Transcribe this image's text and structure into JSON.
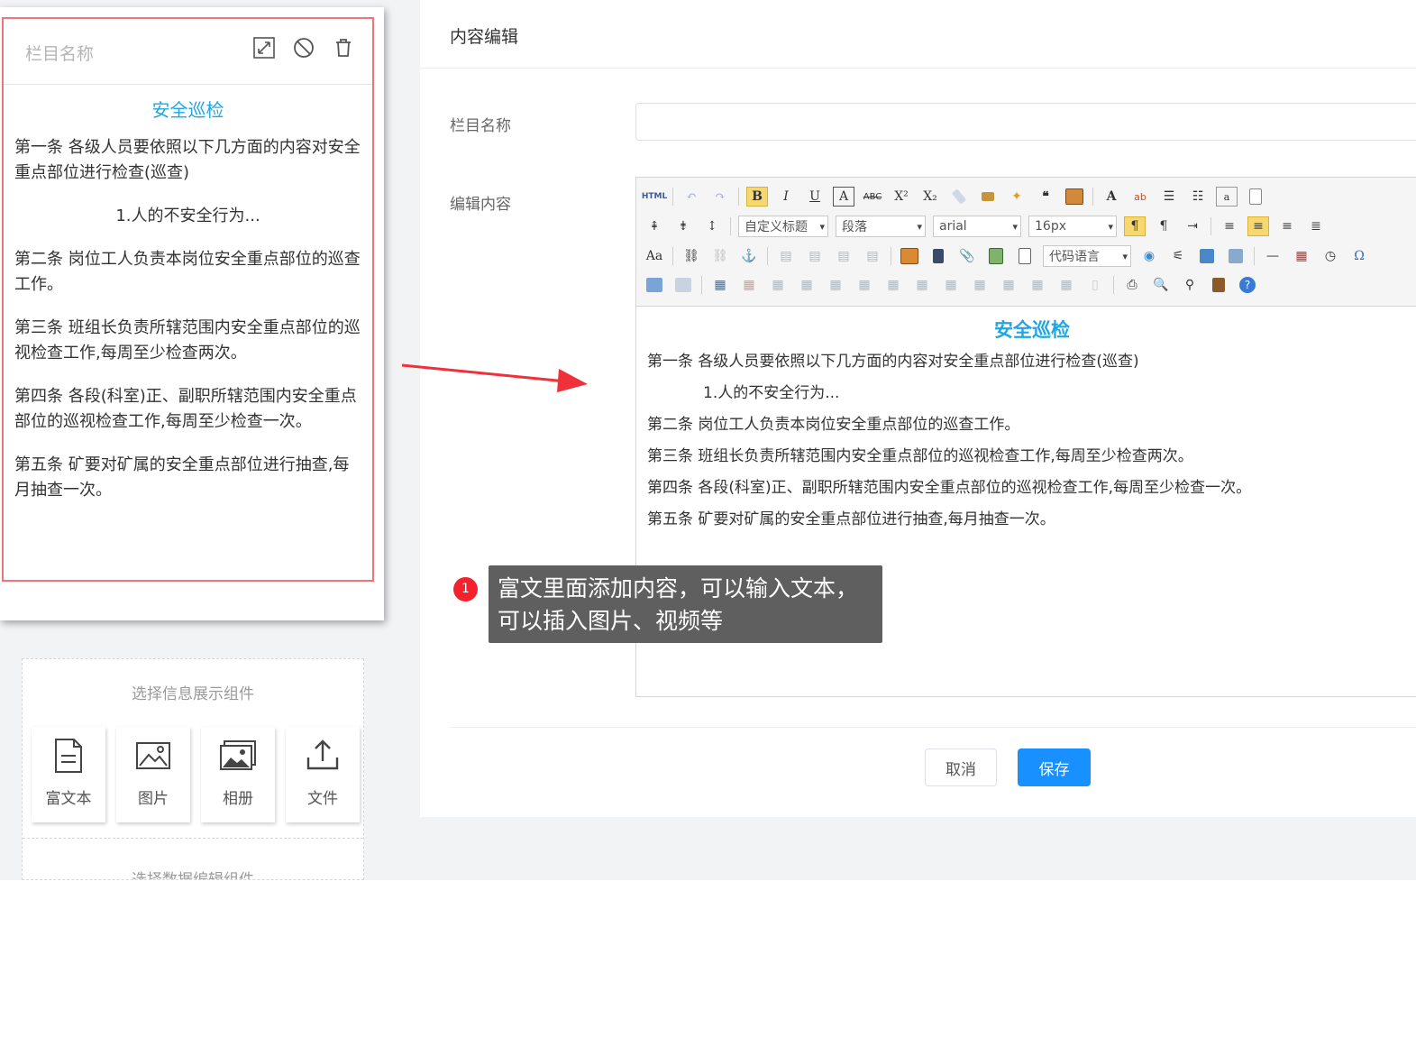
{
  "preview": {
    "column_name_placeholder": "栏目名称",
    "title": "安全巡检",
    "paragraphs": [
      "第一条  各级人员要依照以下几方面的内容对安全重点部位进行检查(巡查)",
      "1.人的不安全行为...",
      "第二条  岗位工人负责本岗位安全重点部位的巡查工作。",
      "第三条  班组长负责所辖范围内安全重点部位的巡视检查工作,每周至少检查两次。",
      "第四条  各段(科室)正、副职所辖范围内安全重点部位的巡视检查工作,每周至少检查一次。",
      "第五条  矿要对矿属的安全重点部位进行抽查,每月抽查一次。"
    ]
  },
  "picker": {
    "title": "选择信息展示组件",
    "components": [
      {
        "label": "富文本",
        "icon": "document-icon"
      },
      {
        "label": "图片",
        "icon": "image-icon"
      },
      {
        "label": "相册",
        "icon": "album-icon"
      },
      {
        "label": "文件",
        "icon": "upload-icon"
      }
    ],
    "title2": "选择数据编辑组件"
  },
  "editor_panel": {
    "title": "内容编辑",
    "column_name_label": "栏目名称",
    "column_name_value": "",
    "content_label": "编辑内容",
    "toolbar": {
      "html_label": "HTML",
      "custom_heading": "自定义标题",
      "paragraph": "段落",
      "font": "arial",
      "font_size": "16px",
      "code_language": "代码语言"
    },
    "content_title": "安全巡检",
    "content_lines": [
      "第一条 各级人员要依照以下几方面的内容对安全重点部位进行检查(巡查)",
      "1.人的不安全行为...",
      "第二条 岗位工人负责本岗位安全重点部位的巡查工作。",
      "第三条 班组长负责所辖范围内安全重点部位的巡视检查工作,每周至少检查两次。",
      "第四条 各段(科室)正、副职所辖范围内安全重点部位的巡视检查工作,每周至少检查一次。",
      "第五条 矿要对矿属的安全重点部位进行抽查,每月抽查一次。"
    ],
    "cancel_label": "取消",
    "save_label": "保存"
  },
  "tooltip": {
    "badge": "1",
    "line1": "富文里面添加内容，可以输入文本，",
    "line2": "可以插入图片、视频等"
  },
  "colors": {
    "accent_title": "#1fa7e5",
    "primary_button": "#1890ff",
    "card_border": "#f0737a",
    "badge": "#f5222d"
  }
}
